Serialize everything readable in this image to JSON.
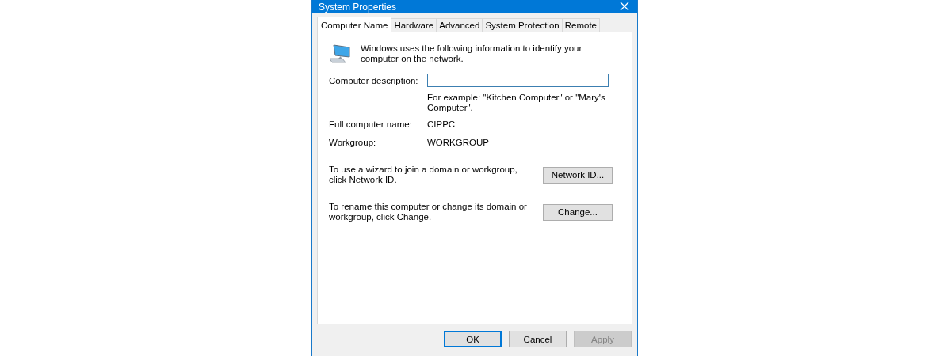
{
  "window": {
    "title": "System Properties"
  },
  "tabs": [
    {
      "label": "Computer Name",
      "selected": true
    },
    {
      "label": "Hardware",
      "selected": false
    },
    {
      "label": "Advanced",
      "selected": false
    },
    {
      "label": "System Protection",
      "selected": false
    },
    {
      "label": "Remote",
      "selected": false
    }
  ],
  "intro": "Windows uses the following information to identify your computer on the network.",
  "description": {
    "label": "Computer description:",
    "hint": "For example: \"Kitchen Computer\" or \"Mary's Computer\"."
  },
  "fields": [
    {
      "label": "Full computer name:",
      "value": "CIPPC"
    },
    {
      "label": "Workgroup:",
      "value": "WORKGROUP"
    }
  ],
  "actions": [
    {
      "text": "To use a wizard to join a domain or workgroup, click Network ID.",
      "button": "Network ID..."
    },
    {
      "text": "To rename this computer or change its domain or workgroup, click Change.",
      "button": "Change..."
    }
  ],
  "buttons": [
    {
      "label": "OK",
      "default": true,
      "disabled": false
    },
    {
      "label": "Cancel",
      "default": false,
      "disabled": false
    },
    {
      "label": "Apply",
      "default": false,
      "disabled": true
    }
  ]
}
